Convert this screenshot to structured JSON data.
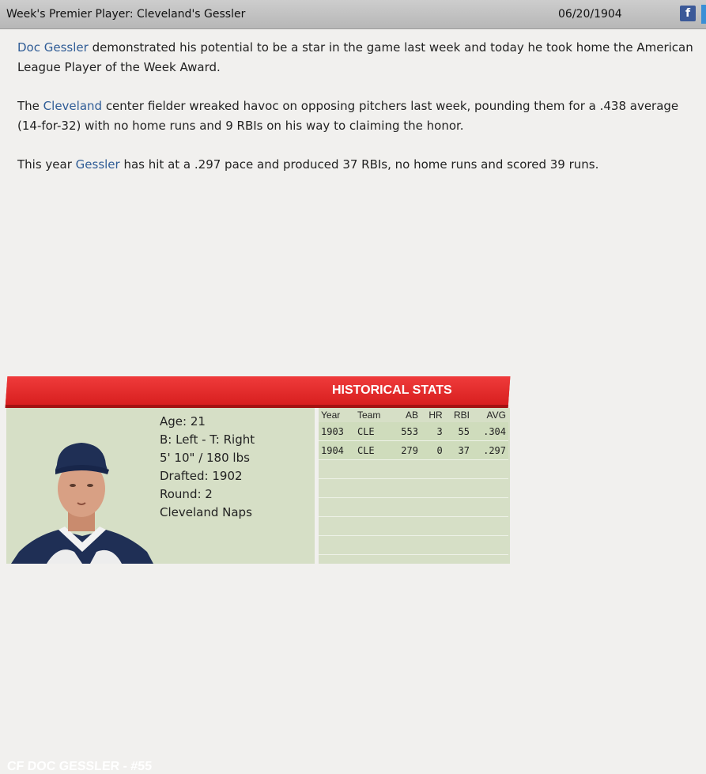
{
  "header": {
    "title": "Week's Premier Player: Cleveland's Gessler",
    "date": "06/20/1904",
    "share_icon": "facebook-icon",
    "share_label": "f"
  },
  "article": {
    "p1_link": "Doc Gessler",
    "p1_text": " demonstrated his potential to be a star in the game last week and today he took home the American League Player of the Week Award.",
    "p2_pre": "The ",
    "p2_link": "Cleveland",
    "p2_text": " center fielder wreaked havoc on opposing pitchers last week, pounding them for a .438 average (14-for-32) with no home runs and 9 RBIs on his way to claiming the honor.",
    "p3_pre": "This year ",
    "p3_link": "Gessler",
    "p3_text": " has hit at a .297 pace and produced 37 RBIs, no home runs and scored 39 runs."
  },
  "card": {
    "player_title": "CF DOC GESSLER - #55",
    "stats_title": "HISTORICAL STATS",
    "age": "Age: 21",
    "bats_throws": "B: Left - T: Right",
    "size": "5' 10\" / 180 lbs",
    "drafted": "Drafted: 1902",
    "round": "Round: 2",
    "team": "Cleveland Naps",
    "portrait_icon": "player-portrait"
  },
  "stats": {
    "headers": [
      "Year",
      "Team",
      "AB",
      "HR",
      "RBI",
      "AVG"
    ],
    "rows": [
      [
        "1903",
        "CLE",
        "553",
        "3",
        "55",
        ".304"
      ],
      [
        "1904",
        "CLE",
        "279",
        "0",
        "37",
        ".297"
      ]
    ]
  },
  "colors": {
    "banner_red": "#e42a2a",
    "card_green": "#d6dfc6",
    "link_blue": "#2f5c96"
  }
}
